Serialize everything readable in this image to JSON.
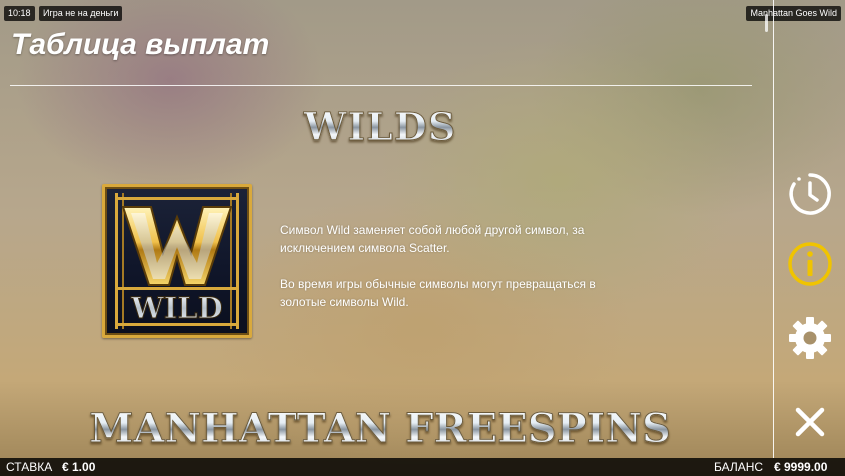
{
  "status": {
    "time": "10:18",
    "notice": "Игра не на деньги",
    "game_name": "Manhattan Goes Wild"
  },
  "page": {
    "title": "Таблица выплат"
  },
  "wilds": {
    "heading": "WILDS",
    "symbol_text": "WILD",
    "symbol_letter": "W",
    "paragraphs": [
      "Символ Wild заменяет собой любой другой символ, за исключением символа Scatter.",
      "Во время игры обычные символы могут превращаться в золотые символы Wild."
    ]
  },
  "freespins": {
    "heading": "MANHATTAN FREESPINS"
  },
  "side_menu": {
    "history_icon": "clock-icon",
    "info_icon": "info-icon",
    "settings_icon": "gear-icon",
    "close_icon": "close-icon",
    "active_color": "#f0c400",
    "icon_color": "#ffffff"
  },
  "bottom_bar": {
    "bet_label": "СТАВКА",
    "bet_value": "€ 1.00",
    "balance_label": "БАЛАНС",
    "balance_value": "€ 9999.00"
  }
}
